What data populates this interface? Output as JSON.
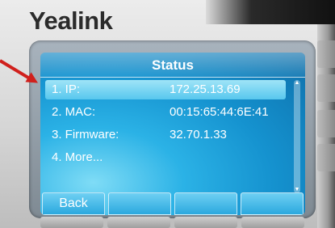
{
  "brand": "Yealink",
  "screen": {
    "title": "Status",
    "items": [
      {
        "label": "1. IP:",
        "value": "172.25.13.69",
        "selected": true
      },
      {
        "label": "2. MAC:",
        "value": "00:15:65:44:6E:41",
        "selected": false
      },
      {
        "label": "3. Firmware:",
        "value": "32.70.1.33",
        "selected": false
      },
      {
        "label": "4. More...",
        "value": "",
        "selected": false
      }
    ],
    "softkeys": [
      "Back",
      "",
      "",
      ""
    ]
  },
  "colors": {
    "screen_blue": "#1592cf",
    "selection_highlight": "#9fe4f7",
    "annotation_arrow": "#d0201c"
  },
  "icons": {
    "scroll_up": "triangle-up-icon",
    "scroll_down": "triangle-down-icon",
    "annotation": "red-arrow-icon"
  }
}
